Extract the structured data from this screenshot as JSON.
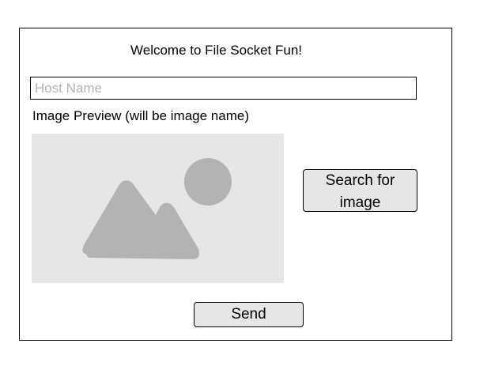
{
  "title": "Welcome to File Socket Fun!",
  "host_input": {
    "value": "",
    "placeholder": "Host Name"
  },
  "preview": {
    "label": "Image Preview (will be image name)",
    "icon": "image-placeholder-icon"
  },
  "buttons": {
    "search_line1": "Search for",
    "search_line2": "image",
    "send": "Send"
  },
  "colors": {
    "placeholder_bg": "#e6e6e6",
    "placeholder_shape": "#b3b3b3",
    "button_bg": "#e6e6e6"
  }
}
